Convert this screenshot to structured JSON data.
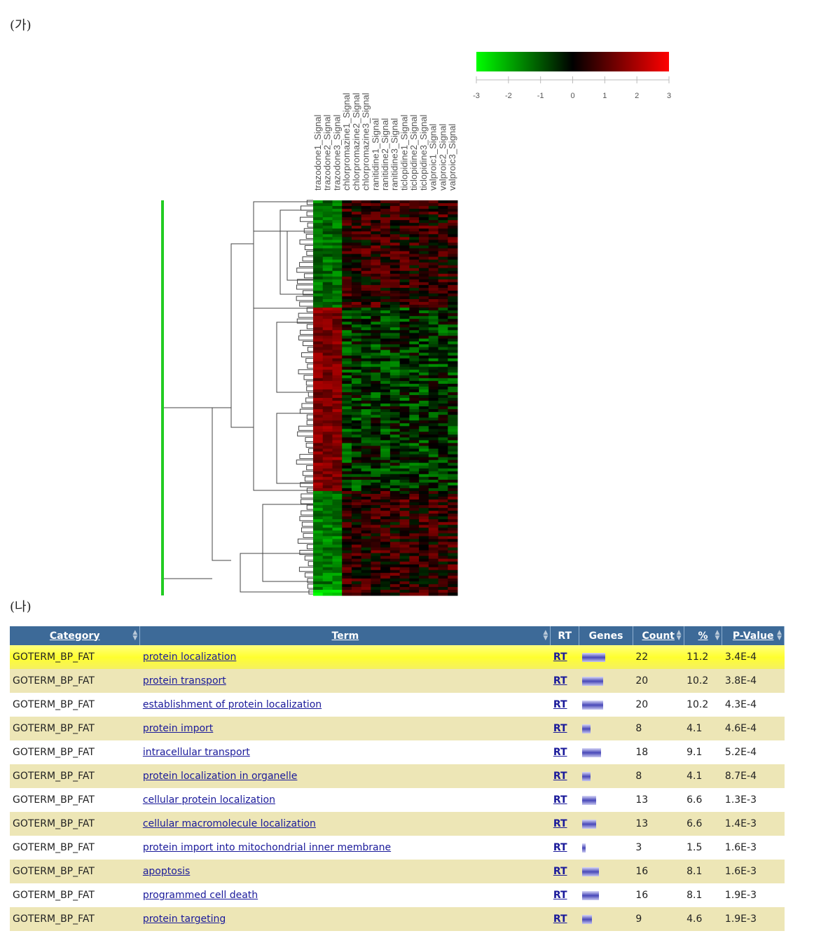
{
  "panel_a_label": "(가)",
  "panel_b_label": "(나)",
  "heatmap": {
    "columns": [
      "trazodone1_Signal",
      "trazodone2_Signal",
      "trazodone3_Signal",
      "chlorpromazine1_Signal",
      "chlorpromazine2_Signal",
      "chlorpromazine3_Signal",
      "ranitidine1_Signal",
      "ranitidine2_Signal",
      "ranitidine3_Signal",
      "ticlopidine1_Signal",
      "ticlopidine2_Signal",
      "ticlopidine3_Signal",
      "valproic1_Signal",
      "valproic2_Signal",
      "valproic3_Signal"
    ],
    "color_scale": {
      "ticks": [
        "-3",
        "-2",
        "-1",
        "0",
        "1",
        "2",
        "3"
      ],
      "low": "#00ff00",
      "mid": "#000000",
      "high": "#ff0000"
    }
  },
  "table": {
    "headers": {
      "category": "Category",
      "term": "Term",
      "rt": "RT",
      "genes": "Genes",
      "count": "Count",
      "percent": "%",
      "pvalue": "P-Value"
    },
    "rows": [
      {
        "category": "GOTERM_BP_FAT",
        "term": "protein localization",
        "rt": "RT",
        "count": "22",
        "percent": "11.2",
        "pvalue": "3.4E-4"
      },
      {
        "category": "GOTERM_BP_FAT",
        "term": "protein transport",
        "rt": "RT",
        "count": "20",
        "percent": "10.2",
        "pvalue": "3.8E-4"
      },
      {
        "category": "GOTERM_BP_FAT",
        "term": "establishment of protein localization",
        "rt": "RT",
        "count": "20",
        "percent": "10.2",
        "pvalue": "4.3E-4"
      },
      {
        "category": "GOTERM_BP_FAT",
        "term": "protein import",
        "rt": "RT",
        "count": "8",
        "percent": "4.1",
        "pvalue": "4.6E-4"
      },
      {
        "category": "GOTERM_BP_FAT",
        "term": "intracellular transport",
        "rt": "RT",
        "count": "18",
        "percent": "9.1",
        "pvalue": "5.2E-4"
      },
      {
        "category": "GOTERM_BP_FAT",
        "term": "protein localization in organelle",
        "rt": "RT",
        "count": "8",
        "percent": "4.1",
        "pvalue": "8.7E-4"
      },
      {
        "category": "GOTERM_BP_FAT",
        "term": "cellular protein localization",
        "rt": "RT",
        "count": "13",
        "percent": "6.6",
        "pvalue": "1.3E-3"
      },
      {
        "category": "GOTERM_BP_FAT",
        "term": "cellular macromolecule localization",
        "rt": "RT",
        "count": "13",
        "percent": "6.6",
        "pvalue": "1.4E-3"
      },
      {
        "category": "GOTERM_BP_FAT",
        "term": "protein import into mitochondrial inner membrane",
        "rt": "RT",
        "count": "3",
        "percent": "1.5",
        "pvalue": "1.6E-3"
      },
      {
        "category": "GOTERM_BP_FAT",
        "term": "apoptosis",
        "rt": "RT",
        "count": "16",
        "percent": "8.1",
        "pvalue": "1.6E-3"
      },
      {
        "category": "GOTERM_BP_FAT",
        "term": "programmed cell death",
        "rt": "RT",
        "count": "16",
        "percent": "8.1",
        "pvalue": "1.9E-3"
      },
      {
        "category": "GOTERM_BP_FAT",
        "term": "protein targeting",
        "rt": "RT",
        "count": "9",
        "percent": "4.6",
        "pvalue": "1.9E-3"
      }
    ]
  }
}
